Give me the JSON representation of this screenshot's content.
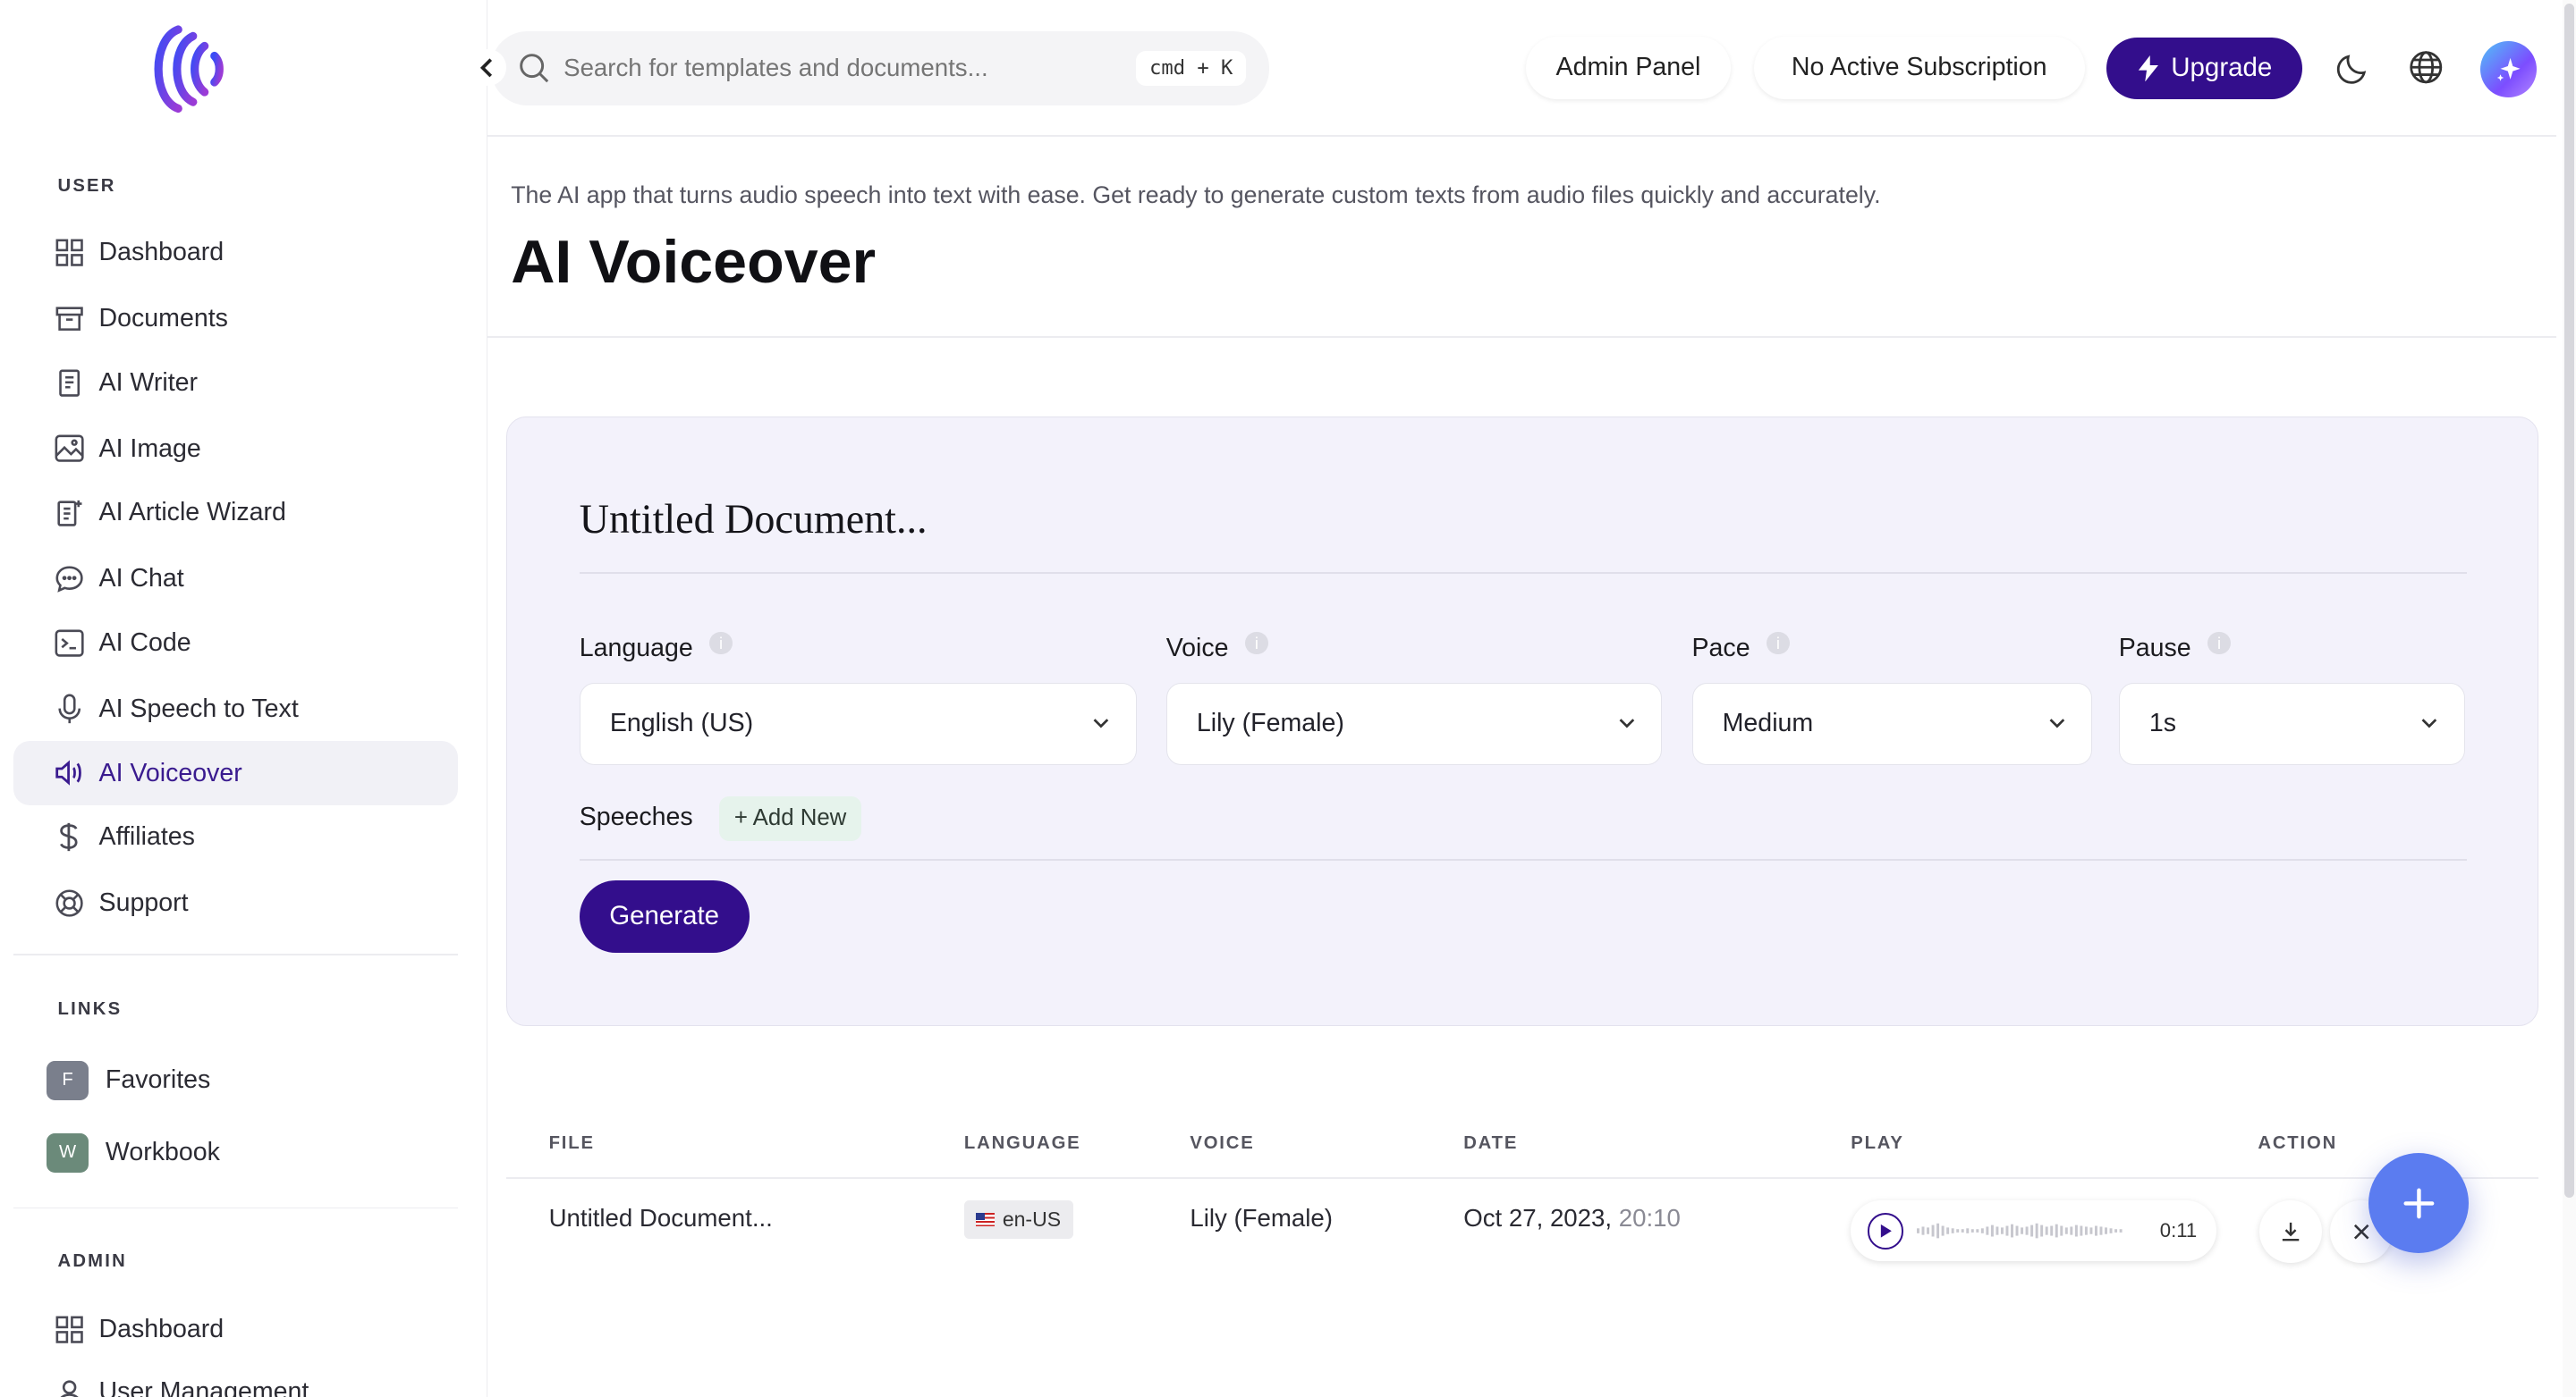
{
  "sidebar": {
    "sections": {
      "user": "USER",
      "links": "LINKS",
      "admin": "ADMIN"
    },
    "user_items": [
      {
        "label": "Dashboard",
        "icon": "grid-icon"
      },
      {
        "label": "Documents",
        "icon": "archive-icon"
      },
      {
        "label": "AI Writer",
        "icon": "document-icon"
      },
      {
        "label": "AI Image",
        "icon": "image-icon"
      },
      {
        "label": "AI Article Wizard",
        "icon": "wizard-icon"
      },
      {
        "label": "AI Chat",
        "icon": "chat-icon"
      },
      {
        "label": "AI Code",
        "icon": "terminal-icon"
      },
      {
        "label": "AI Speech to Text",
        "icon": "microphone-icon"
      },
      {
        "label": "AI Voiceover",
        "icon": "speaker-icon",
        "active": true
      },
      {
        "label": "Affiliates",
        "icon": "dollar-icon"
      },
      {
        "label": "Support",
        "icon": "lifebuoy-icon"
      }
    ],
    "links": [
      {
        "badge": "F",
        "label": "Favorites",
        "color": "#7a7f8c"
      },
      {
        "badge": "W",
        "label": "Workbook",
        "color": "#6b8a7a"
      }
    ],
    "admin_items": [
      {
        "label": "Dashboard",
        "icon": "grid-icon"
      },
      {
        "label": "User Management",
        "icon": "user-icon"
      }
    ]
  },
  "header": {
    "search_placeholder": "Search for templates and documents...",
    "shortcut": "cmd + K",
    "admin_panel": "Admin Panel",
    "subscription": "No Active Subscription",
    "upgrade": "Upgrade"
  },
  "page": {
    "subtitle": "The AI app that turns audio speech into text with ease. Get ready to generate custom texts from audio files quickly and accurately.",
    "title": "AI Voiceover"
  },
  "form": {
    "doc_title": "Untitled Document...",
    "language_label": "Language",
    "language_value": "English (US)",
    "voice_label": "Voice",
    "voice_value": "Lily (Female)",
    "pace_label": "Pace",
    "pace_value": "Medium",
    "pause_label": "Pause",
    "pause_value": "1s",
    "speeches_label": "Speeches",
    "add_new": "+ Add New",
    "generate": "Generate",
    "info_glyph": "i"
  },
  "table": {
    "headers": [
      "FILE",
      "LANGUAGE",
      "VOICE",
      "DATE",
      "PLAY",
      "ACTION"
    ],
    "rows": [
      {
        "file": "Untitled Document...",
        "language": "en-US",
        "voice": "Lily (Female)",
        "date": "Oct 27, 2023,",
        "time": "20:10",
        "duration": "0:11"
      }
    ]
  },
  "colors": {
    "accent": "#330e8c",
    "card_bg": "#f3f2fb",
    "fab": "#5b7cf0"
  }
}
